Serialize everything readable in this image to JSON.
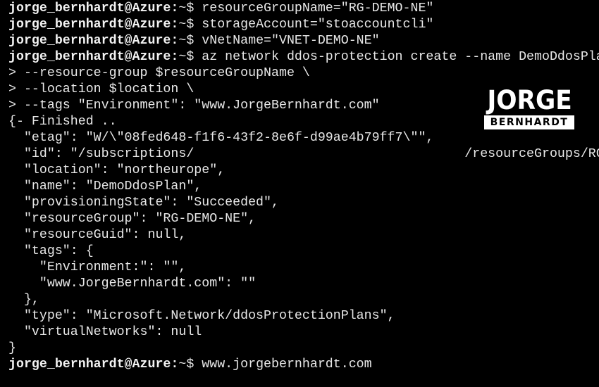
{
  "terminal": {
    "lines": [
      {
        "prompt": "jorge_bernhardt@Azure:",
        "text": "~$ resourceGroupName=\"RG-DEMO-NE\""
      },
      {
        "prompt": "jorge_bernhardt@Azure:",
        "text": "~$ storageAccount=\"stoaccountcli\""
      },
      {
        "prompt": "jorge_bernhardt@Azure:",
        "text": "~$ vNetName=\"VNET-DEMO-NE\""
      },
      {
        "prompt": "jorge_bernhardt@Azure:",
        "text": "~$ az network ddos-protection create --name DemoDdosPlan \\"
      },
      {
        "prompt": "",
        "text": "> --resource-group $resourceGroupName \\"
      },
      {
        "prompt": "",
        "text": "> --location $location \\"
      },
      {
        "prompt": "",
        "text": "> --tags \"Environment\": \"www.JorgeBernhardt.com\""
      },
      {
        "prompt": "",
        "text": "{- Finished .."
      },
      {
        "prompt": "",
        "text": "  \"etag\": \"W/\\\"08fed648-f1f6-43f2-8e6f-d99ae4b79ff7\\\"\","
      },
      {
        "prompt": "",
        "text": "  \"id\": \"/subscriptions/                                   /resourceGroups/RG-DEMO-NE\","
      },
      {
        "prompt": "",
        "text": "  \"location\": \"northeurope\","
      },
      {
        "prompt": "",
        "text": "  \"name\": \"DemoDdosPlan\","
      },
      {
        "prompt": "",
        "text": "  \"provisioningState\": \"Succeeded\","
      },
      {
        "prompt": "",
        "text": "  \"resourceGroup\": \"RG-DEMO-NE\","
      },
      {
        "prompt": "",
        "text": "  \"resourceGuid\": null,"
      },
      {
        "prompt": "",
        "text": "  \"tags\": {"
      },
      {
        "prompt": "",
        "text": "    \"Environment:\": \"\","
      },
      {
        "prompt": "",
        "text": "    \"www.JorgeBernhardt.com\": \"\""
      },
      {
        "prompt": "",
        "text": "  },"
      },
      {
        "prompt": "",
        "text": "  \"type\": \"Microsoft.Network/ddosProtectionPlans\","
      },
      {
        "prompt": "",
        "text": "  \"virtualNetworks\": null"
      },
      {
        "prompt": "",
        "text": "}"
      },
      {
        "prompt": "jorge_bernhardt@Azure:",
        "text": "~$ www.jorgebernhardt.com"
      }
    ]
  },
  "logo": {
    "top": "JORGE",
    "bottom": "BERNHARDT"
  }
}
